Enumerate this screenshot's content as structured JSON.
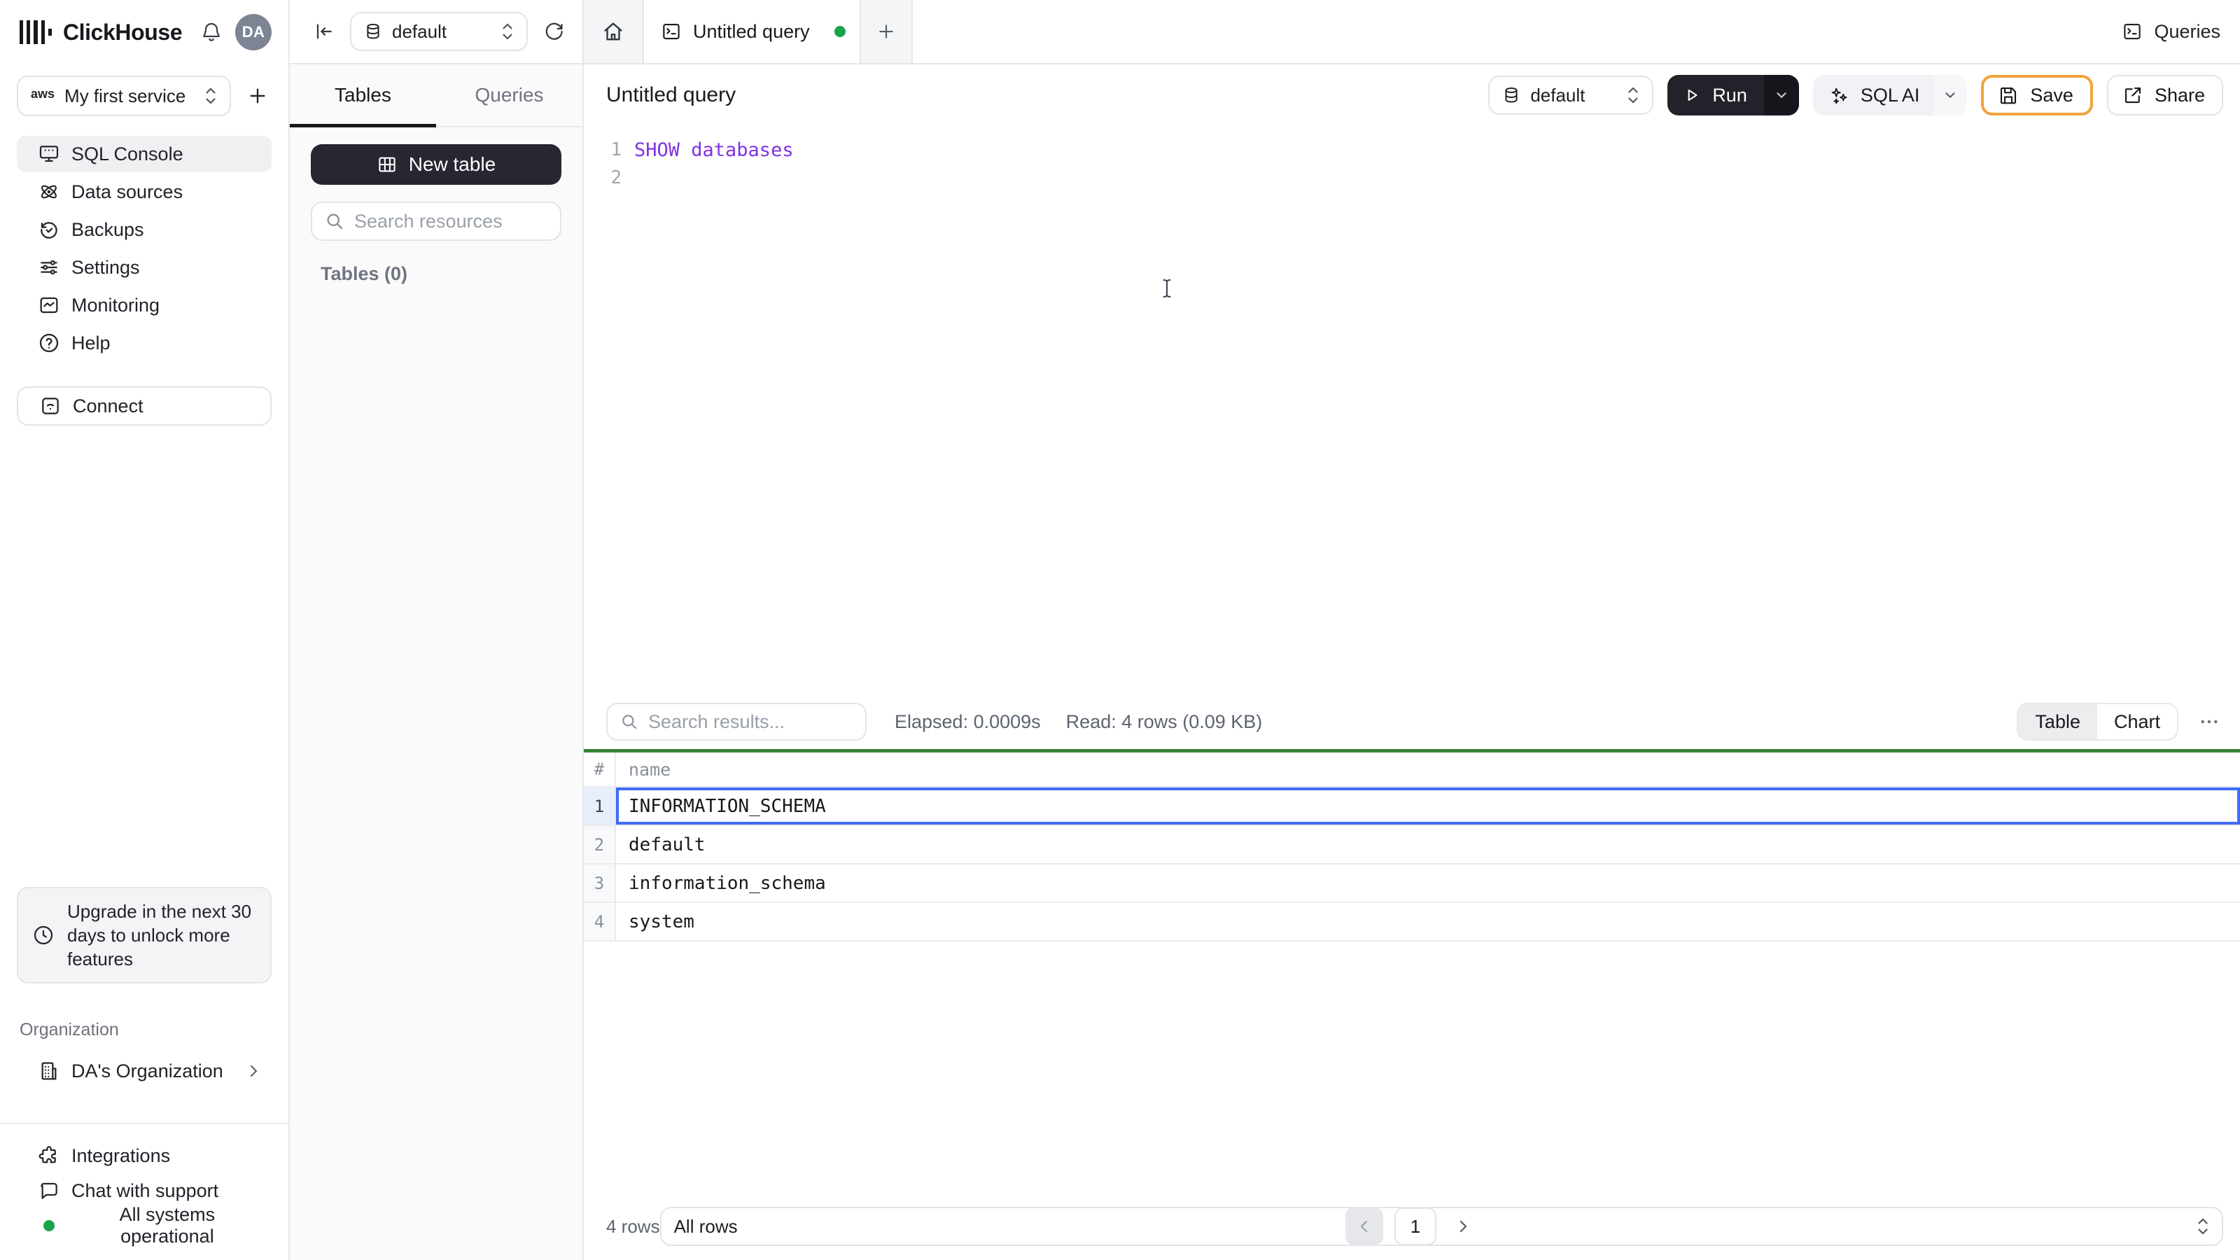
{
  "brand": {
    "name": "ClickHouse",
    "avatar_initials": "DA"
  },
  "sidebar": {
    "service_selector": {
      "provider": "aws",
      "label": "My first service"
    },
    "nav": [
      {
        "label": "SQL Console"
      },
      {
        "label": "Data sources"
      },
      {
        "label": "Backups"
      },
      {
        "label": "Settings"
      },
      {
        "label": "Monitoring"
      },
      {
        "label": "Help"
      }
    ],
    "connect_label": "Connect",
    "upgrade_notice": "Upgrade in the next 30 days to unlock more features",
    "organization_section_label": "Organization",
    "organization_name": "DA's Organization",
    "footer_items": [
      {
        "label": "Integrations"
      },
      {
        "label": "Chat with support"
      },
      {
        "label": "All systems operational"
      }
    ]
  },
  "explorer": {
    "tabs": [
      {
        "label": "Tables"
      },
      {
        "label": "Queries"
      }
    ],
    "database_selector": "default",
    "new_table_label": "New table",
    "search_placeholder": "Search resources",
    "section_label": "Tables (0)"
  },
  "workspace": {
    "tab_title": "Untitled query",
    "queries_button_label": "Queries",
    "query_title": "Untitled query",
    "database_selector": "default",
    "run_label": "Run",
    "sql_ai_label": "SQL AI",
    "save_label": "Save",
    "share_label": "Share",
    "editor": {
      "lines": [
        {
          "number": "1",
          "code": "SHOW databases"
        },
        {
          "number": "2",
          "code": ""
        }
      ]
    }
  },
  "results": {
    "search_placeholder": "Search results...",
    "elapsed": "Elapsed: 0.0009s",
    "read": "Read: 4 rows (0.09 KB)",
    "view_toggle": [
      {
        "label": "Table"
      },
      {
        "label": "Chart"
      }
    ],
    "table": {
      "columns": [
        "#",
        "name"
      ],
      "rows": [
        {
          "n": "1",
          "name": "INFORMATION_SCHEMA"
        },
        {
          "n": "2",
          "name": "default"
        },
        {
          "n": "3",
          "name": "information_schema"
        },
        {
          "n": "4",
          "name": "system"
        }
      ],
      "selected_row": "1"
    },
    "footer": {
      "row_count": "4 rows",
      "current_page": "1",
      "page_size": "All rows"
    }
  },
  "icons": {
    "logo": "clickhouse-bars",
    "bell": "notification-bell",
    "sql_console": "presentation-screen",
    "data_sources": "orbit",
    "backups": "history-clock",
    "settings": "sliders",
    "monitoring": "line-chart-frame",
    "help": "question-circle",
    "connect": "signal-square",
    "upgrade": "clock",
    "organization": "building",
    "integrations": "puzzle",
    "chat": "speech-bubble",
    "status": "green-dot",
    "back": "arrow-left-to-bar",
    "database": "cylinder",
    "refresh": "circular-arrow",
    "home": "house",
    "query_tab": "terminal-window",
    "run": "play-triangle",
    "sql_ai": "sparkles",
    "save": "floppy-disk",
    "share": "arrow-out-of-box",
    "search": "magnifier",
    "more": "ellipsis"
  },
  "colors": {
    "accent_purple": "#7f33e3",
    "dark_button": "#232129",
    "save_border_amber": "#f2a33c",
    "result_divider_green": "#38833b",
    "selection_blue": "#3d6bfa",
    "status_green": "#17a34a"
  }
}
